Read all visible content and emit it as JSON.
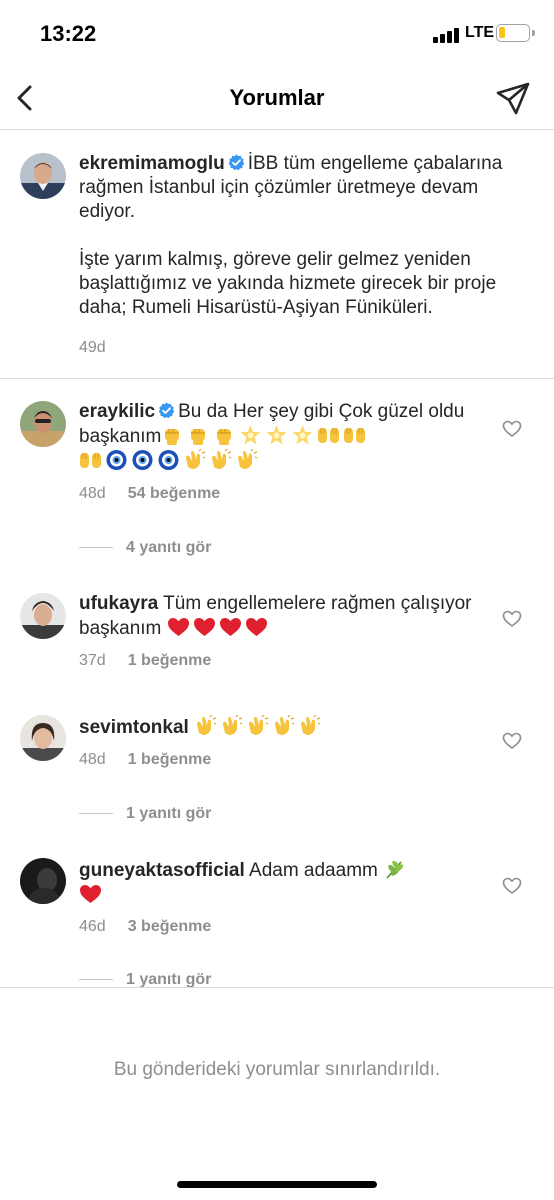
{
  "status": {
    "time": "13:22",
    "network": "LTE",
    "battery_level": 0.2
  },
  "nav": {
    "title": "Yorumlar",
    "back_icon": "chevron-left-icon",
    "send_icon": "paper-plane-icon"
  },
  "caption": {
    "username": "ekremimamoglu",
    "verified": true,
    "text_p1": "İBB tüm engelleme çabalarına rağmen İstanbul için çözümler üretmeye devam ediyor.",
    "text_p2": "İşte yarım kalmış, göreve gelir gelmez yeniden başlattığımız ve yakında hizmete girecek bir proje daha; Rumeli Hisarüstü-Aşiyan Füniküleri.",
    "time": "49d"
  },
  "comments": [
    {
      "username": "eraykilic",
      "verified": true,
      "text": "Bu da Her şey gibi Çok güzel oldu başkanım",
      "emojis_line1": [
        "raised-fist",
        "raised-fist",
        "raised-fist",
        "glowing-star",
        "glowing-star",
        "glowing-star",
        "raising-hands",
        "raising-hands"
      ],
      "emojis_line2": [
        "raising-hands",
        "nazar-amulet",
        "nazar-amulet",
        "nazar-amulet",
        "clapping-hands",
        "clapping-hands",
        "clapping-hands"
      ],
      "time": "48d",
      "likes": "54 beğenme",
      "replies": "4 yanıtı gör"
    },
    {
      "username": "ufukayra",
      "verified": false,
      "text": "Tüm engellemelere rağmen çalışıyor başkanım",
      "emojis": [
        "red-heart",
        "red-heart",
        "red-heart",
        "red-heart"
      ],
      "time": "37d",
      "likes": "1 beğenme"
    },
    {
      "username": "sevimtonkal",
      "verified": false,
      "text": "",
      "emojis": [
        "clapping-hands",
        "clapping-hands",
        "clapping-hands",
        "clapping-hands",
        "clapping-hands"
      ],
      "time": "48d",
      "likes": "1 beğenme",
      "replies": "1 yanıtı gör"
    },
    {
      "username": "guneyaktasofficial",
      "verified": false,
      "text": "Adam adaamm",
      "emojis": [
        "herb",
        "red-heart"
      ],
      "time": "46d",
      "likes": "3 beğenme",
      "replies": "1 yanıtı gör"
    }
  ],
  "footer": {
    "text": "Bu gönderideki yorumlar sınırlandırıldı."
  },
  "colors": {
    "verified": "#3897f0",
    "secondary_text": "#8e8e8e",
    "divider": "#dbdbdb",
    "heart": "#ed3d3d"
  }
}
